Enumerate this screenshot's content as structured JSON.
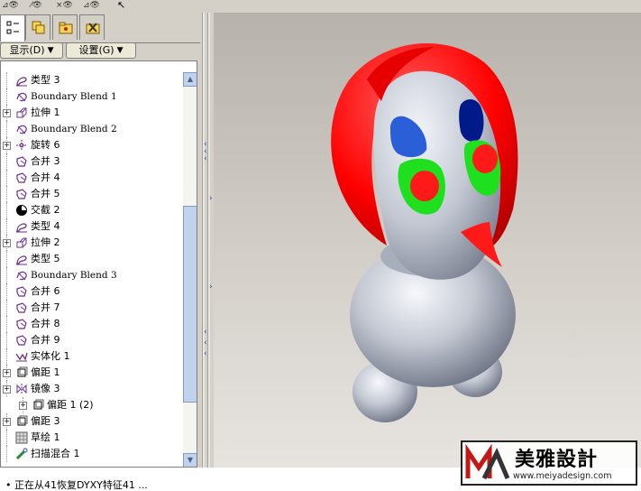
{
  "toolbar": {
    "icons": [
      "eye-feature-icon",
      "eye-edit-icon",
      "eye-delete-icon",
      "eye-settings-icon",
      "select-cursor-icon"
    ]
  },
  "tabs": [
    "model-tree-tab",
    "layers-tab",
    "folder-tab",
    "favorites-tab"
  ],
  "buttons": {
    "show": "显示(D)",
    "settings": "设置(G)"
  },
  "tree": {
    "items": [
      {
        "label": "类型 3",
        "icon": "style-icon",
        "expand": false,
        "indent": 0
      },
      {
        "label": "Boundary Blend 1",
        "icon": "boundary-blend-icon",
        "expand": false,
        "indent": 0
      },
      {
        "label": "拉伸 1",
        "icon": "extrude-icon",
        "expand": true,
        "indent": 0
      },
      {
        "label": "Boundary Blend 2",
        "icon": "boundary-blend-icon",
        "expand": false,
        "indent": 0
      },
      {
        "label": "旋转 6",
        "icon": "revolve-icon",
        "expand": true,
        "indent": 0
      },
      {
        "label": "合并 3",
        "icon": "merge-icon",
        "expand": false,
        "indent": 0
      },
      {
        "label": "合并 4",
        "icon": "merge-icon",
        "expand": false,
        "indent": 0
      },
      {
        "label": "合并 5",
        "icon": "merge-icon",
        "expand": false,
        "indent": 0
      },
      {
        "label": "交截 2",
        "icon": "intersect-icon",
        "expand": false,
        "indent": 0
      },
      {
        "label": "类型 4",
        "icon": "style-icon",
        "expand": false,
        "indent": 0
      },
      {
        "label": "拉伸 2",
        "icon": "extrude-icon",
        "expand": true,
        "indent": 0
      },
      {
        "label": "类型 5",
        "icon": "style-icon",
        "expand": false,
        "indent": 0
      },
      {
        "label": "Boundary Blend 3",
        "icon": "boundary-blend-icon",
        "expand": false,
        "indent": 0
      },
      {
        "label": "合并 6",
        "icon": "merge-icon",
        "expand": false,
        "indent": 0
      },
      {
        "label": "合并 7",
        "icon": "merge-icon",
        "expand": false,
        "indent": 0
      },
      {
        "label": "合并 8",
        "icon": "merge-icon",
        "expand": false,
        "indent": 0
      },
      {
        "label": "合并 9",
        "icon": "merge-icon",
        "expand": false,
        "indent": 0
      },
      {
        "label": "实体化 1",
        "icon": "solidify-icon",
        "expand": false,
        "indent": 0
      },
      {
        "label": "偏距 1",
        "icon": "offset-icon",
        "expand": true,
        "indent": 0
      },
      {
        "label": "镜像 3",
        "icon": "mirror-icon",
        "expand": true,
        "indent": 0
      },
      {
        "label": "偏距 1 (2)",
        "icon": "offset-icon",
        "expand": true,
        "indent": 1
      },
      {
        "label": "偏距 3",
        "icon": "offset-icon",
        "expand": true,
        "indent": 0
      },
      {
        "label": "草绘 1",
        "icon": "sketch-icon",
        "expand": false,
        "indent": 0
      },
      {
        "label": "扫描混合 1",
        "icon": "swept-blend-icon",
        "expand": false,
        "indent": 0
      }
    ]
  },
  "status": {
    "text": "• 正在从41恢复DYXY特征41 ..."
  },
  "watermark": {
    "brand": "美雅設計",
    "url": "www.meiyadesign.com"
  },
  "colors": {
    "hair": "#ff1a1a",
    "head": "#c9ced8",
    "eye_blue": "#2255cc",
    "eye_navy": "#001a8a",
    "eye_green": "#1ee01e",
    "pupil": "#ff1a1a",
    "tree_icon": "#6b2f8f",
    "scroll_thumb": "#c1d2ee"
  }
}
